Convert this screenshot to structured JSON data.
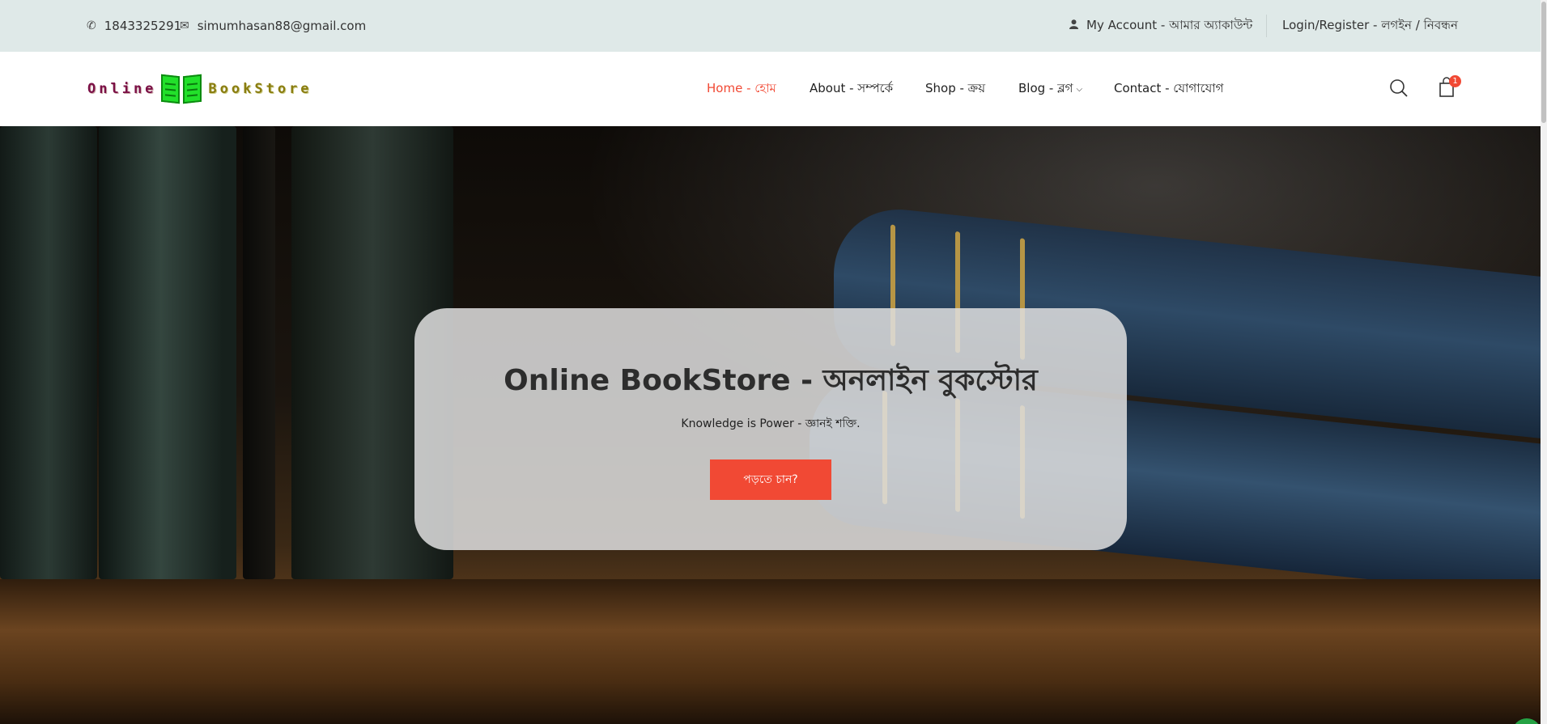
{
  "topbar": {
    "phone": "1843325291",
    "email": "simumhasan88@gmail.com",
    "account": "My Account - আমার অ্যাকাউন্ট",
    "login": "Login/Register - লগইন / নিবন্ধন",
    "phone_icon": "phone-icon",
    "email_icon": "envelope-icon",
    "user_icon": "user-icon"
  },
  "logo": {
    "word1": "Online",
    "word2": "BookStore",
    "icon": "open-book-icon"
  },
  "nav": {
    "home": "Home - হোম",
    "about": "About - সম্পর্কে",
    "shop": "Shop - ক্রয়",
    "blog": "Blog - ব্লগ",
    "contact": "Contact - যোগাযোগ",
    "chevron": "⌄"
  },
  "header_icons": {
    "search": "search-icon",
    "cart": "shopping-bag-icon",
    "cart_count": "1"
  },
  "hero": {
    "title": "Online BookStore - অনলাইন বুকস্টোর",
    "subtitle": "Knowledge is Power - জ্ঞানই শক্তি.",
    "button": "পড়তে চান?"
  },
  "colors": {
    "accent": "#f14934",
    "topbar_bg": "#dfe9e8"
  }
}
